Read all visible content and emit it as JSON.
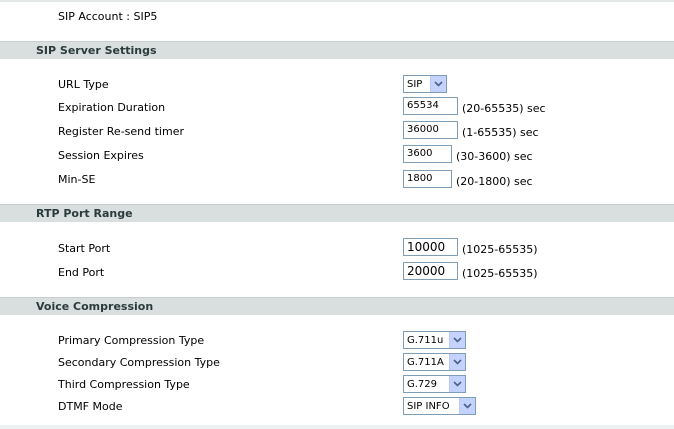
{
  "account": {
    "label": "SIP Account : SIP5"
  },
  "sections": {
    "sip": {
      "title": "SIP Server Settings"
    },
    "rtp": {
      "title": "RTP Port Range"
    },
    "voice": {
      "title": "Voice Compression"
    }
  },
  "sip_server": {
    "url_type": {
      "label": "URL Type",
      "value": "SIP"
    },
    "expiration": {
      "label": "Expiration Duration",
      "value": "65534",
      "hint": "(20-65535) sec"
    },
    "resend": {
      "label": "Register Re-send timer",
      "value": "36000",
      "hint": "(1-65535) sec"
    },
    "session": {
      "label": "Session Expires",
      "value": "3600",
      "hint": "(30-3600) sec"
    },
    "minse": {
      "label": "Min-SE",
      "value": "1800",
      "hint": "(20-1800) sec"
    }
  },
  "rtp": {
    "start": {
      "label": "Start Port",
      "value": "10000",
      "hint": "(1025-65535)"
    },
    "end": {
      "label": "End Port",
      "value": "20000",
      "hint": "(1025-65535)"
    }
  },
  "voice": {
    "primary": {
      "label": "Primary Compression Type",
      "value": "G.711u"
    },
    "secondary": {
      "label": "Secondary Compression Type",
      "value": "G.711A"
    },
    "third": {
      "label": "Third Compression Type",
      "value": "G.729"
    },
    "dtmf": {
      "label": "DTMF Mode",
      "value": "SIP INFO"
    }
  },
  "icons": {
    "dropdown": "chevron-down-icon"
  },
  "colors": {
    "header_bg": "#d9dfdf",
    "field_border": "#7f9db9",
    "dropdown_button": "#c3d3fd"
  }
}
